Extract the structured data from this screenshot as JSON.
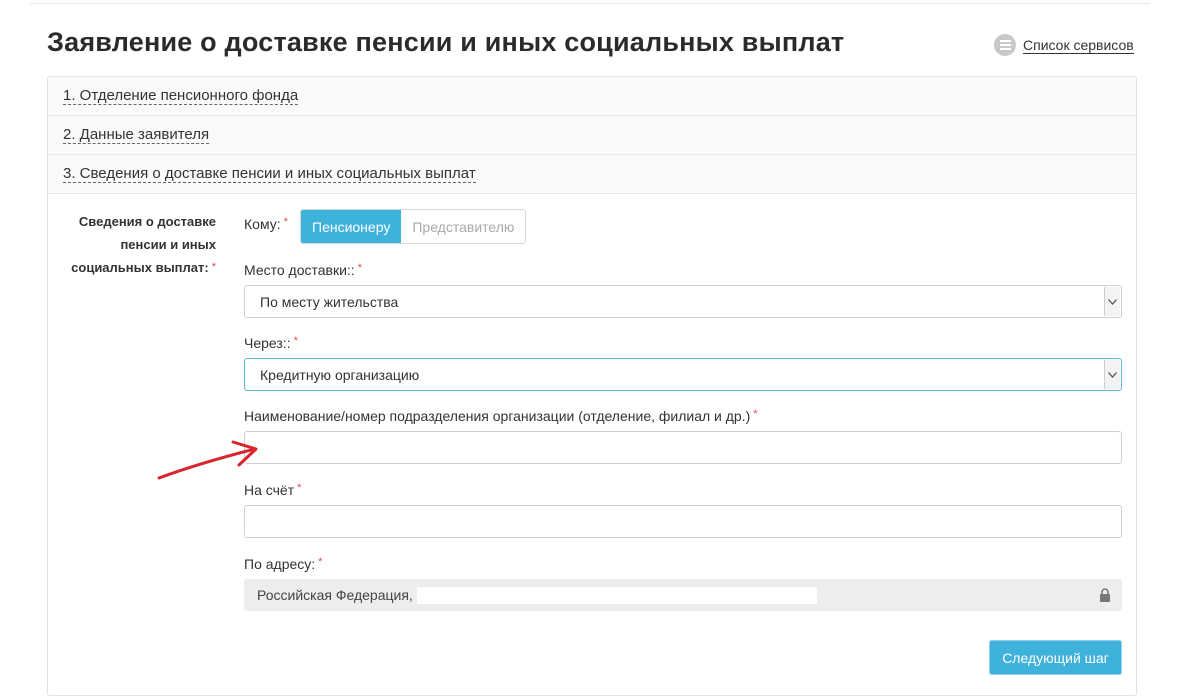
{
  "header": {
    "title": "Заявление о доставке пенсии и иных социальных выплат",
    "services_link": "Список сервисов"
  },
  "steps": [
    {
      "label": "1. Отделение пенсионного фонда"
    },
    {
      "label": "2. Данные заявителя"
    },
    {
      "label": "3. Сведения о доставке пенсии и иных социальных выплат"
    }
  ],
  "form": {
    "section_label_lines": [
      "Сведения о доставке",
      "пенсии и иных",
      "социальных выплат:"
    ],
    "required_mark": "*",
    "recipient": {
      "label": "Кому:",
      "options": [
        "Пенсионеру",
        "Представителю"
      ],
      "selected": "Пенсионеру"
    },
    "delivery_place": {
      "label": "Место доставки::",
      "value": "По месту жительства"
    },
    "via": {
      "label": "Через::",
      "value": "Кредитную организацию"
    },
    "branch_name": {
      "label": "Наименование/номер подразделения организации (отделение, филиал и др.)",
      "value": ""
    },
    "account": {
      "label": "На счёт",
      "value": ""
    },
    "address": {
      "label": "По адресу:",
      "value": "Российская Федерация,"
    },
    "next_button": "Следующий шаг"
  },
  "colors": {
    "accent": "#3fb2dc",
    "required": "#e04b4b",
    "arrow": "#d9232d"
  },
  "icons": [
    "list-icon",
    "chevron-down-icon",
    "lock-icon",
    "arrow-annotation"
  ]
}
